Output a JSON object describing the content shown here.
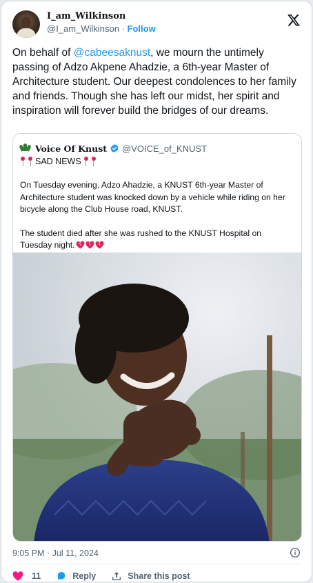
{
  "author": {
    "display_name": "I_am_Wilkinson",
    "handle": "@I_am_Wilkinson",
    "separator": "·",
    "follow_label": "Follow"
  },
  "tweet": {
    "text_before_mention": "On behalf of ",
    "mention": "@cabeesaknust",
    "text_after_mention": ", we mourn the untimely passing of Adzo Akpene Ahadzie, a 6th-year Master of Architecture student. Our deepest condolences to her family and friends. Though she has left our midst, her spirit and inspiration will forever build the bridges of our dreams."
  },
  "quote": {
    "display_name": "Voice Of Knust",
    "handle": "@VOICE_of_KNUST",
    "sad_news": "SAD NEWS",
    "paragraph_1": "On Tuesday evening, Adzo Ahadzie, a KNUST 6th-year Master of Architecture student was knocked down by a vehicle while riding on her bicycle along the Club House road, KNUST.",
    "paragraph_2": "The student died after she was rushed to the KNUST Hospital on Tuesday night."
  },
  "meta": {
    "timestamp": "9:05 PM · Jul 11, 2024"
  },
  "actions": {
    "like_count": "11",
    "reply_label": "Reply",
    "share_label": "Share this post"
  },
  "icons": [
    "x-logo-icon",
    "verified-badge-icon",
    "broken-heart-icon",
    "pin-icon",
    "heart-icon",
    "reply-icon",
    "share-icon",
    "info-icon"
  ],
  "colors": {
    "link": "#1d9bf0",
    "secondary_text": "#536471",
    "like": "#f91880",
    "broken_heart": "#e0245e"
  }
}
